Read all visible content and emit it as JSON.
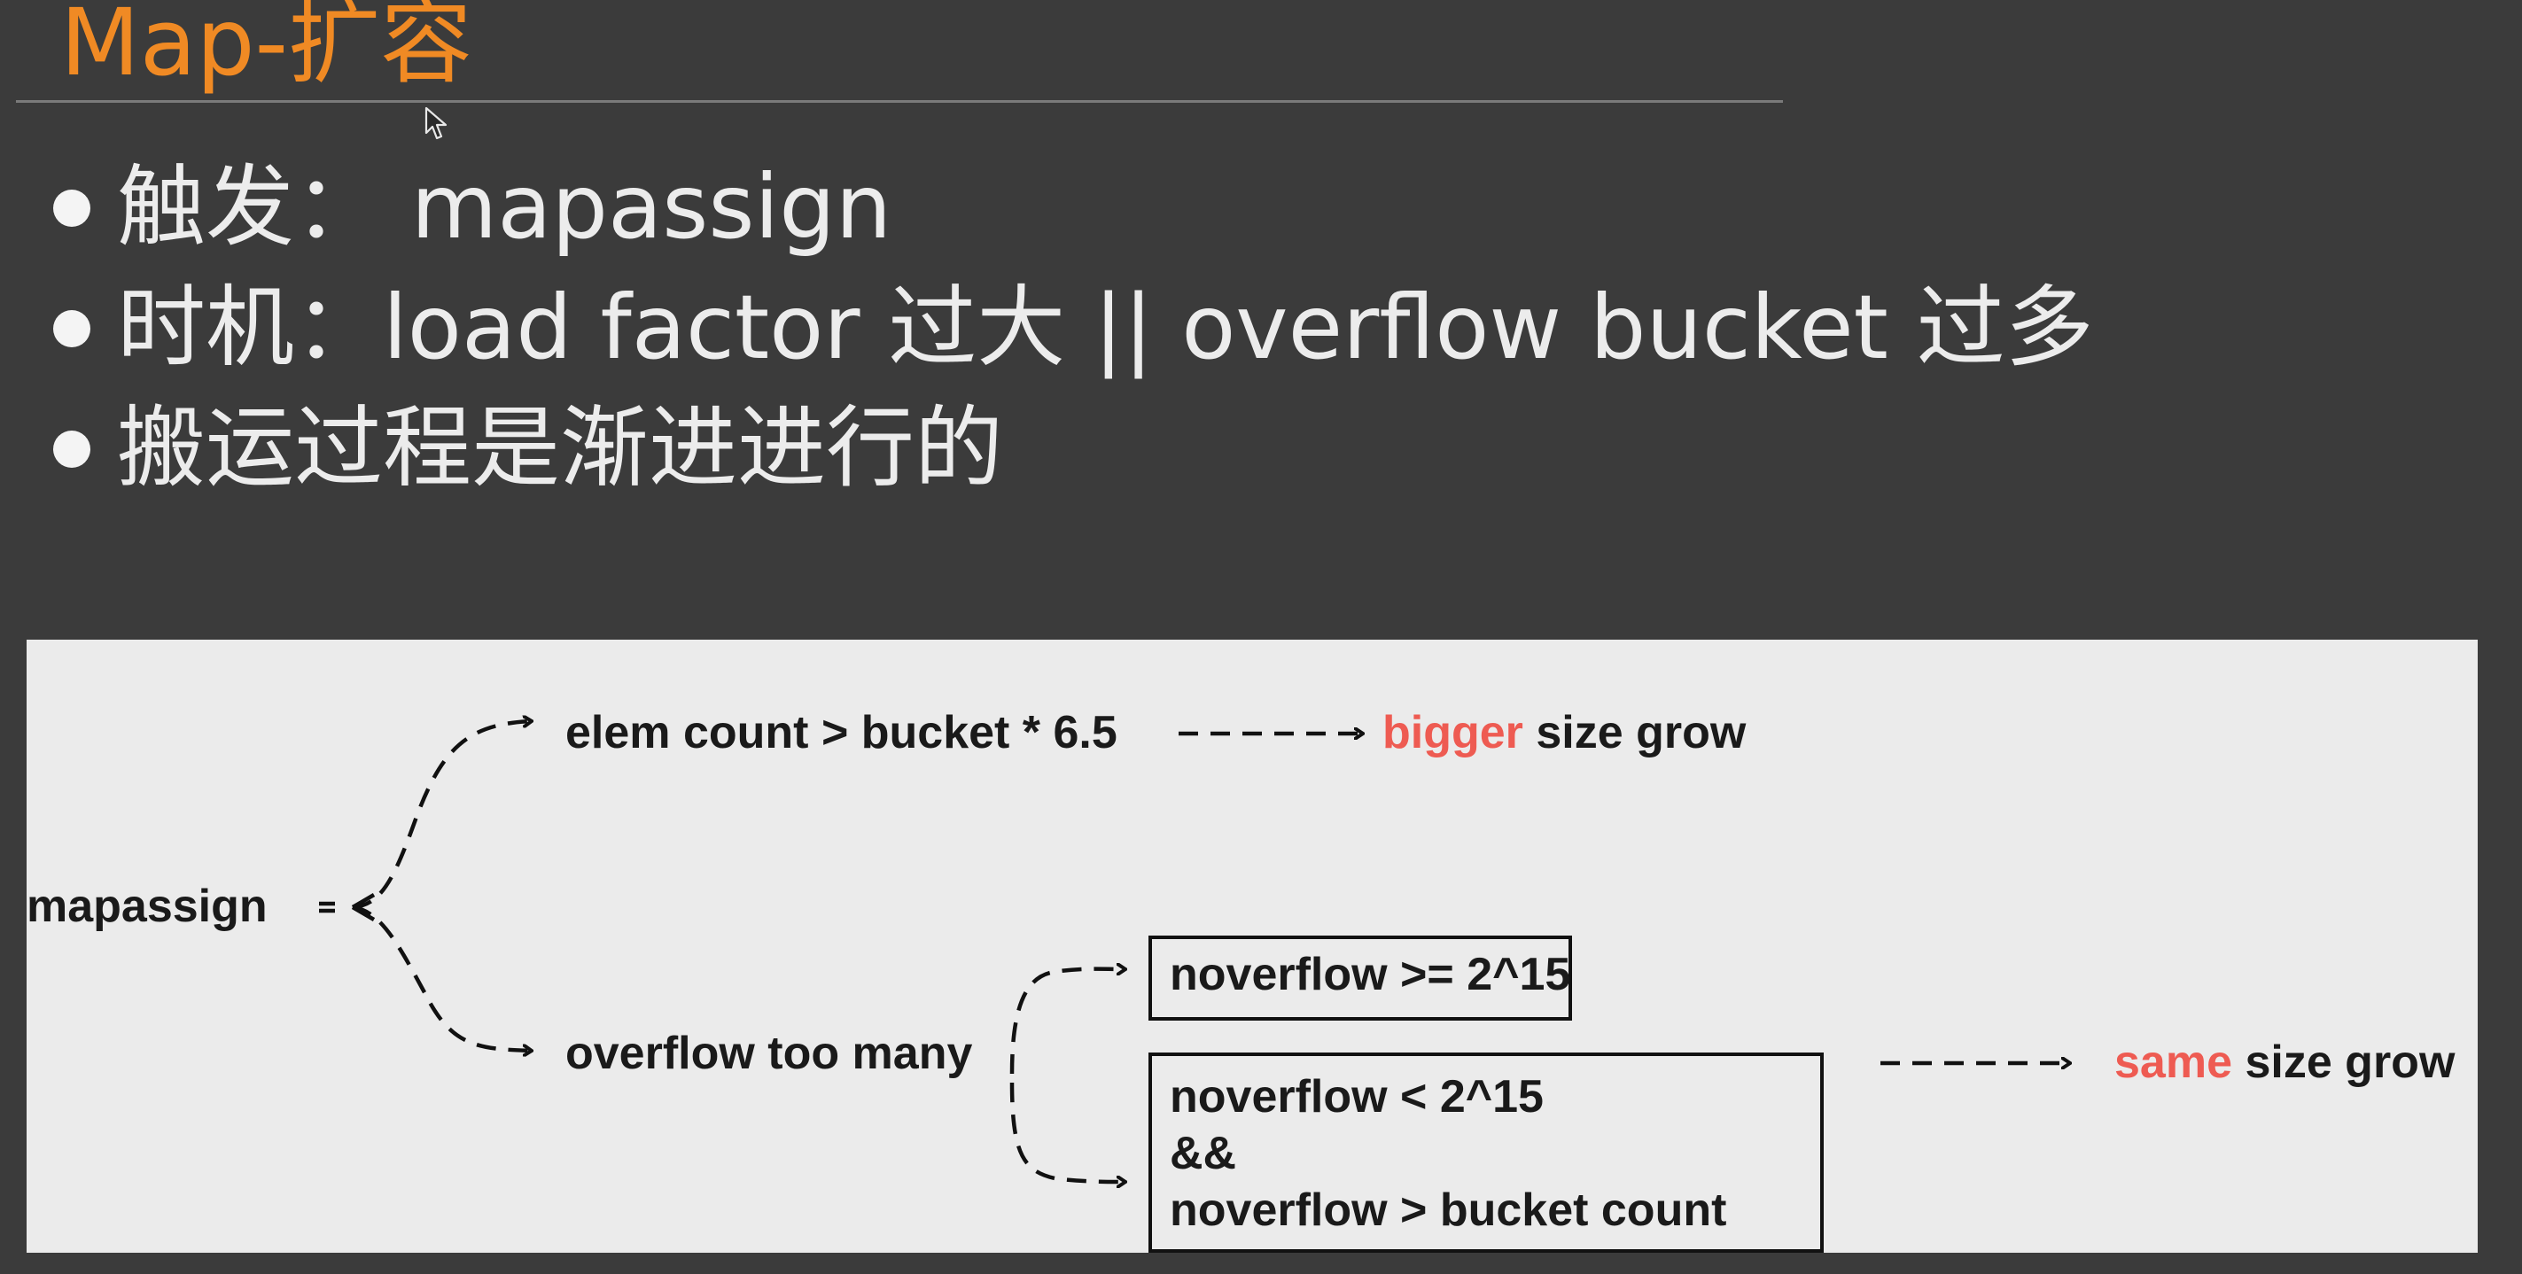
{
  "title": "Map-扩容",
  "bullets": [
    {
      "text": "触发： mapassign"
    },
    {
      "text": "时机：load factor 过大 || overflow bucket 过多"
    },
    {
      "text": "搬运过程是渐进进行的"
    }
  ],
  "diagram": {
    "root": "mapassign",
    "branch_top": "elem count > bucket * 6.5",
    "branch_bottom": "overflow too many",
    "result_top_accent": "bigger",
    "result_top_rest": " size grow",
    "box_a": "noverflow >= 2^15",
    "box_b_line1": "noverflow < 2^15",
    "box_b_line2": "&&",
    "box_b_line3": "noverflow > bucket count",
    "result_bottom_accent": "same",
    "result_bottom_rest": " size grow"
  },
  "colors": {
    "background": "#3b3b3b",
    "title": "#f08a24",
    "bullet_text": "#ececec",
    "panel": "#ebebeb",
    "accent": "#ee5b52",
    "ink": "#1a1a1a"
  },
  "icons": {
    "cursor": "mouse-pointer-icon",
    "bullet": "bullet-dot-icon",
    "arrow": "dashed-arrow-icon"
  }
}
